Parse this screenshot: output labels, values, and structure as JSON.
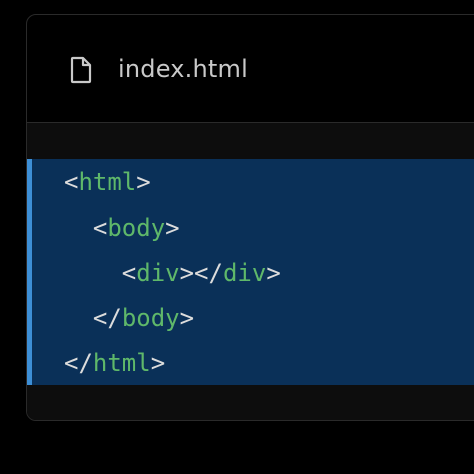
{
  "file_tab": {
    "icon": "file-icon",
    "name": "index.html"
  },
  "colors": {
    "background": "#000000",
    "code_background": "#0a3058",
    "accent": "#3d8fd6",
    "tag_name": "#5fb86a",
    "punctuation": "#dcdcdc",
    "file_name_text": "#c9c9c9"
  },
  "code": {
    "lines": [
      {
        "indent": "",
        "open": "<",
        "tag": "html",
        "close": ">"
      },
      {
        "indent": "  ",
        "open": "<",
        "tag": "body",
        "close": ">"
      },
      {
        "indent": "    ",
        "open": "<",
        "tag": "div",
        "mid": "></",
        "tag2": "div",
        "close": ">"
      },
      {
        "indent": "  ",
        "open": "</",
        "tag": "body",
        "close": ">"
      },
      {
        "indent": "",
        "open": "</",
        "tag": "html",
        "close": ">"
      }
    ]
  }
}
